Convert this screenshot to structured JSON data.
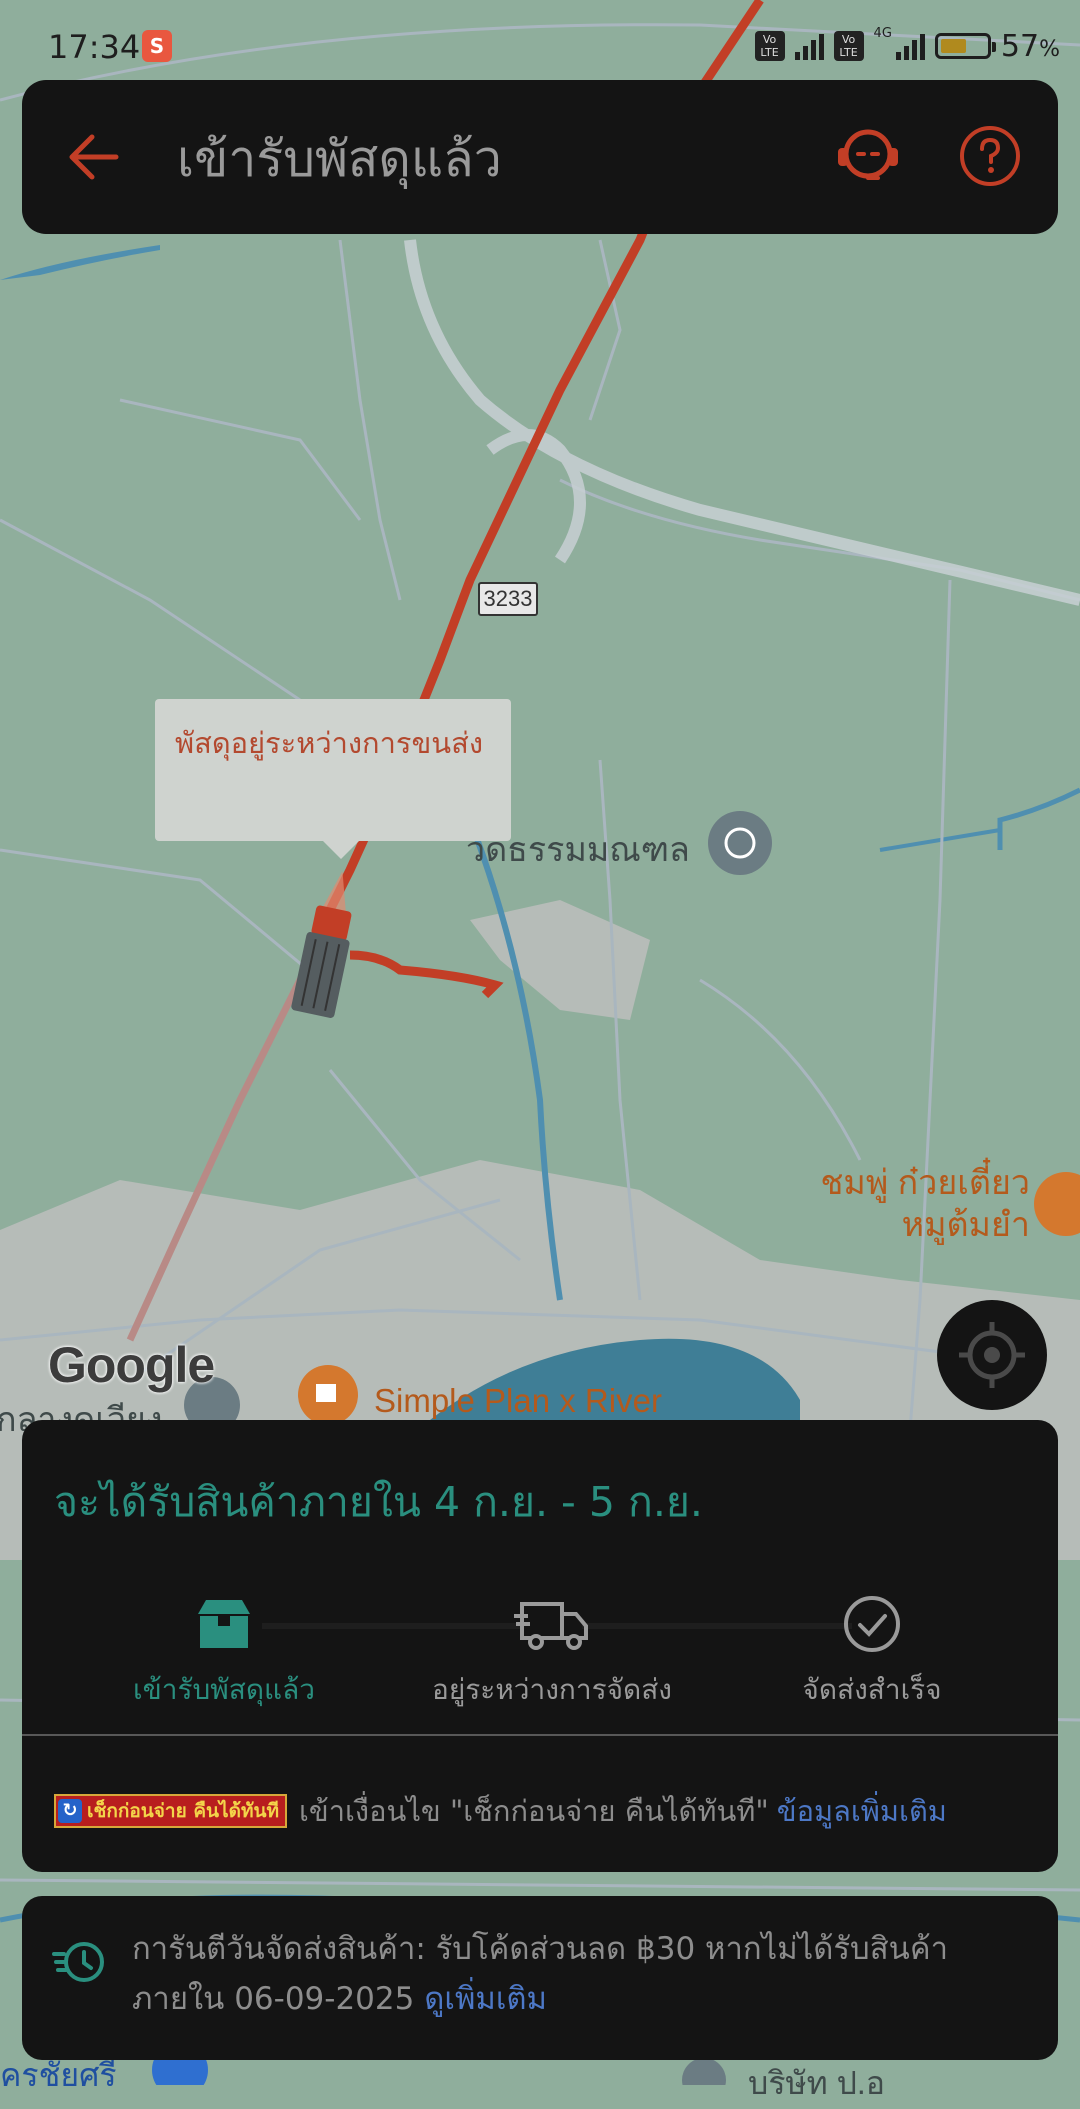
{
  "status_bar": {
    "time": "17:34",
    "volte_1": "Vo LTE",
    "volte_2": "Vo LTE",
    "network": "4G",
    "battery_percent": "57",
    "battery_unit": "%",
    "battery_level": 0.57
  },
  "header": {
    "title": "เข้ารับพัสดุแล้ว",
    "back_icon": "arrow-left-icon",
    "support_icon": "headset-agent-icon",
    "help_icon": "question-circle-icon",
    "accent_color": "#c23e26"
  },
  "map": {
    "callout_text": "พัสดุอยู่ระหว่างการขนส่ง",
    "route_number": "3233",
    "temple_label": "วัดธรรมมณฑล",
    "restaurant_label_line1": "ชมพู่ ก๋วยเตี๋ยว",
    "restaurant_label_line2": "หมูต้มยำ",
    "cafe_label": "Simple Plan x River",
    "google_logo": "Google",
    "left_edge_label": "กลางดูเวียง",
    "bottom_left_label": "ครชัยศรี",
    "bottom_right_label": "บริษัท ป.อ",
    "locate_icon": "crosshair-target-icon",
    "route_color": "#c23e26"
  },
  "delivery": {
    "eta_text": "จะได้รับสินค้าภายใน 4 ก.ย. - 5 ก.ย.",
    "steps": [
      {
        "label": "เข้ารับพัสดุแล้ว",
        "icon": "package-box-icon",
        "active": true
      },
      {
        "label": "อยู่ระหว่างการจัดส่ง",
        "icon": "delivery-truck-icon",
        "active": false
      },
      {
        "label": "จัดส่งสำเร็จ",
        "icon": "check-circle-icon",
        "active": false
      }
    ],
    "active_color": "#2a8f7f",
    "promo_badge": "เช็กก่อนจ่าย คืนได้ทันที",
    "promo_text": "เข้าเงื่อนไข \"เช็กก่อนจ่าย คืนได้ทันที\"",
    "promo_link": "ข้อมูลเพิ่มเติม"
  },
  "guarantee": {
    "icon": "clock-fast-icon",
    "text": "การันตีวันจัดส่งสินค้า: รับโค้ดส่วนลด ฿30 หากไม่ได้รับสินค้าภายใน 06-09-2025",
    "link": "ดูเพิ่มเติม"
  }
}
